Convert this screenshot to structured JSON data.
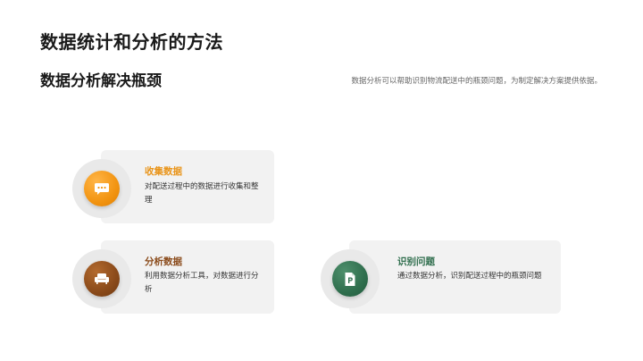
{
  "page": {
    "title": "数据统计和分析的方法",
    "section_title": "数据分析解决瓶颈",
    "intro": "数据分析可以帮助识别物流配送中的瓶颈问题，为制定解决方案提供依据。"
  },
  "colors": {
    "orange": "#f29411",
    "brown": "#8a4a1a",
    "green": "#2f6e4d",
    "card_bg": "#f2f2f2"
  },
  "cards": [
    {
      "icon": "chat-bubble-icon",
      "title": "收集数据",
      "description": "对配送过程中的数据进行收集和整理"
    },
    {
      "icon": "sofa-icon",
      "title": "分析数据",
      "description": "利用数据分析工具，对数据进行分析"
    },
    {
      "icon": "document-p-icon",
      "title": "识别问题",
      "description": "通过数据分析，识别配送过程中的瓶颈问题"
    }
  ]
}
